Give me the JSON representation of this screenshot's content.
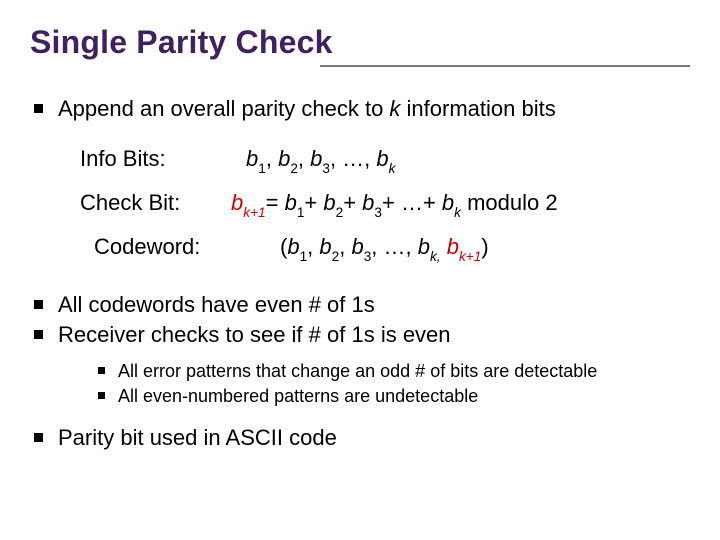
{
  "slide": {
    "title": "Single Parity Check",
    "bullet1_pre": "Append an overall parity check to ",
    "bullet1_kvar": "k",
    "bullet1_post": " information bits",
    "defs": {
      "info_label": "Info Bits:",
      "info_b": "b",
      "info_i1": "1",
      "info_i2": "2",
      "info_i3": "3",
      "info_dots": ", …, ",
      "info_ik": "k",
      "check_label": "Check Bit:",
      "check_b": "b",
      "check_kp1": "k+1",
      "check_eq": "= ",
      "check_i1": "1",
      "check_plus": "+ ",
      "check_i2": "2",
      "check_i3": "3",
      "check_dots": "+ …+ ",
      "check_ik": "k",
      "check_mod": "   modulo 2",
      "code_label": "Codeword:",
      "code_open": "(",
      "code_b": "b",
      "code_i1": "1",
      "code_i2": "2",
      "code_i3": "3",
      "code_dots": ", …, ",
      "code_ik": "k,",
      "code_ikp1": "k+1",
      "code_close": ")"
    },
    "bullet2": "All codewords have even # of 1s",
    "bullet3": "Receiver checks to see if # of 1s is even",
    "sub_a": "All error patterns that change an odd # of bits are detectable",
    "sub_b": "All even-numbered patterns are undetectable",
    "bullet4": "Parity bit used in ASCII code"
  }
}
